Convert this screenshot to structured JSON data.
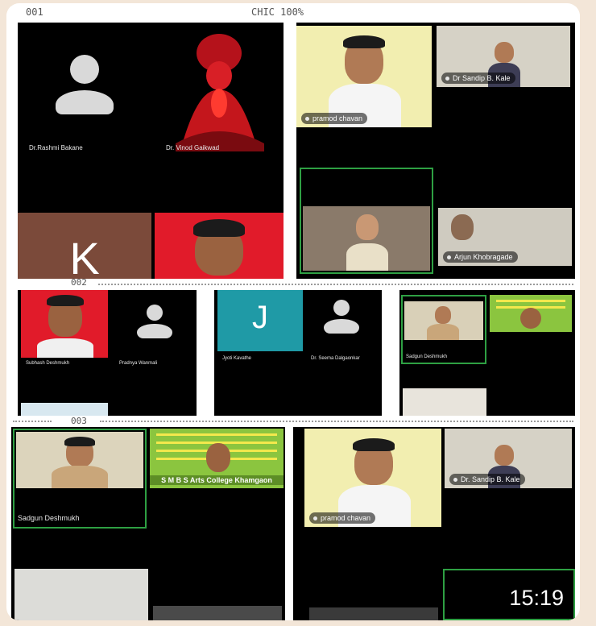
{
  "strips": {
    "s1_left": "001",
    "s1_center": "CHIC 100%",
    "s2_label": "002",
    "s3_label": "003"
  },
  "grid1": {
    "rashmi": "Dr.Rashmi Bakane",
    "vinod": "Dr. Vinod Gaikwad",
    "tile_k_letter": "K",
    "pramod": "pramod chavan",
    "sandip": "Dr Sandip B. Kale",
    "arjun": "Arjun Khobragade"
  },
  "grid2": {
    "subhash": "Subhash Deshmukh",
    "pradnya": "Pradnya Wanmali",
    "tile_j_letter": "J",
    "jyoti": "Jyoti Kavathe",
    "seema": "Dr. Seema Dalgaonkar",
    "sadgun": "Sadgun Deshmukh"
  },
  "grid3": {
    "sadgun": "Sadgun Deshmukh",
    "college": "S M B S Arts College Khamgaon",
    "pramod": "pramod chavan",
    "sandip": "Dr. Sandip B. Kale"
  },
  "clock": "15:19",
  "colors": {
    "active_speaker": "#2ea043",
    "tile_k_bg": "#7b4a3a",
    "tile_j_bg": "#1f9aa6",
    "banner_bg": "#8bc53f"
  }
}
